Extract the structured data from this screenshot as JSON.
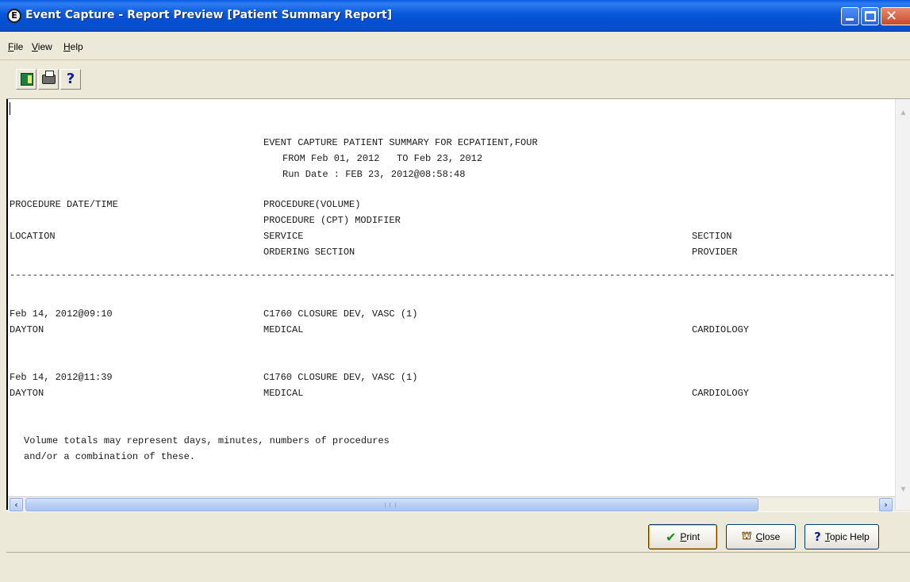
{
  "window": {
    "title": "Event Capture - Report Preview [Patient Summary Report]",
    "icon_letter": "E"
  },
  "menu": {
    "file_mnemonic": "F",
    "file_rest": "ile",
    "view_mnemonic": "V",
    "view_rest": "iew",
    "help_mnemonic": "H",
    "help_rest": "elp"
  },
  "toolbar": {
    "help_glyph": "?"
  },
  "report": {
    "header_line1": "EVENT CAPTURE PATIENT SUMMARY FOR ECPATIENT,FOUR",
    "header_line2": "FROM Feb 01, 2012   TO Feb 23, 2012",
    "header_line3": "Run Date : FEB 23, 2012@08:58:48",
    "col_procedure_datetime": "PROCEDURE DATE/TIME",
    "col_procedure_volume": "PROCEDURE(VOLUME)",
    "col_procedure_cpt_modifier": "PROCEDURE (CPT) MODIFIER",
    "col_location": "LOCATION",
    "col_service": "SERVICE",
    "col_section": "SECTION",
    "col_ordering_section": "ORDERING SECTION",
    "col_provider": "PROVIDER",
    "separator": "-----------------------------------------------------------------------------------------------------------------------------------------------------------------",
    "rows": [
      {
        "datetime": "Feb 14, 2012@09:10",
        "procedure": "C1760 CLOSURE DEV, VASC (1)",
        "location": "DAYTON",
        "service": "MEDICAL",
        "section": "CARDIOLOGY"
      },
      {
        "datetime": "Feb 14, 2012@11:39",
        "procedure": "C1760 CLOSURE DEV, VASC (1)",
        "location": "DAYTON",
        "service": "MEDICAL",
        "section": "CARDIOLOGY"
      }
    ],
    "footnote_line1": "Volume totals may represent days, minutes, numbers of procedures",
    "footnote_line2": "and/or a combination of these."
  },
  "buttons": {
    "print_mnemonic": "P",
    "print_rest": "rint",
    "close_mnemonic": "C",
    "close_rest": "lose",
    "help_mnemonic": "T",
    "help_rest": "opic Help"
  }
}
